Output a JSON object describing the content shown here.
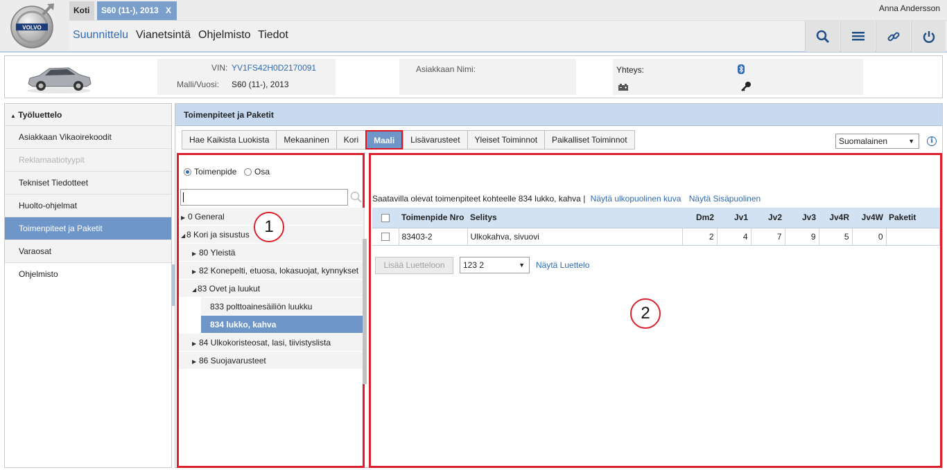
{
  "header": {
    "tabs": [
      {
        "label": "Koti"
      },
      {
        "label": "S60 (11-), 2013",
        "close": "X"
      }
    ],
    "user": "Anna Andersson",
    "nav": [
      {
        "label": "Suunnittelu",
        "active": true
      },
      {
        "label": "Vianetsintä"
      },
      {
        "label": "Ohjelmisto"
      },
      {
        "label": "Tiedot"
      }
    ],
    "toolbar_icons": [
      "search-icon",
      "list-icon",
      "link-icon",
      "power-icon"
    ]
  },
  "vehicle": {
    "vin_label": "VIN:",
    "vin": "YV1FS42H0D2170091",
    "model_label": "Malli/Vuosi:",
    "model": "S60 (11-), 2013",
    "customer_label": "Asiakkaan Nimi:",
    "connection_label": "Yhteys:",
    "icons": [
      "bluetooth-icon",
      "battery-icon",
      "key-icon"
    ]
  },
  "sidebar": {
    "title": "Työluettelo",
    "items": [
      {
        "label": "Asiakkaan Vikaoirekoodit"
      },
      {
        "label": "Reklamaatiotyypit",
        "disabled": true
      },
      {
        "label": "Tekniset Tiedotteet"
      },
      {
        "label": "Huolto-ohjelmat"
      },
      {
        "label": "Toimenpiteet ja Paketit",
        "active": true
      },
      {
        "label": "Varaosat"
      },
      {
        "label": "Ohjelmisto"
      }
    ]
  },
  "main": {
    "title": "Toimenpiteet ja Paketit",
    "tabs": [
      "Hae Kaikista Luokista",
      "Mekaaninen",
      "Kori",
      "Maali",
      "Lisävarusteet",
      "Yleiset Toiminnot",
      "Paikalliset Toiminnot"
    ],
    "active_tab": "Maali",
    "language": "Suomalainen",
    "info_icon": "i"
  },
  "panel1": {
    "callout": "1",
    "radio_operation": "Toimenpide",
    "radio_part": "Osa",
    "search_value": "",
    "tree": [
      {
        "label": "0 General",
        "level": 0,
        "state": "collapsed"
      },
      {
        "label": "8 Kori ja sisustus",
        "level": 0,
        "state": "expanded"
      },
      {
        "label": "80 Yleistä",
        "level": 1,
        "state": "collapsed"
      },
      {
        "label": "82 Konepelti, etuosa, lokasuojat, kynnykset",
        "level": 1,
        "state": "collapsed"
      },
      {
        "label": "83 Ovet ja luukut",
        "level": 1,
        "state": "expanded"
      },
      {
        "label": "833 polttoainesäiliön luukku",
        "level": 2,
        "state": "leaf"
      },
      {
        "label": "834 lukko, kahva",
        "level": 2,
        "state": "leaf",
        "selected": true
      },
      {
        "label": "84 Ulkokoristeosat, lasi, tiivistyslista",
        "level": 1,
        "state": "collapsed"
      },
      {
        "label": "86 Suojavarusteet",
        "level": 1,
        "state": "collapsed"
      }
    ]
  },
  "panel2": {
    "callout": "2",
    "available_text": "Saatavilla olevat toimenpiteet kohteelle 834 lukko, kahva |",
    "link_outside": "Näytä ulkopuolinen kuva",
    "link_inside": "Näytä Sisäpuolinen",
    "columns": [
      "Toimenpide Nro",
      "Selitys",
      "Dm2",
      "Jv1",
      "Jv2",
      "Jv3",
      "Jv4R",
      "Jv4W",
      "Paketit"
    ],
    "rows": [
      {
        "nro": "83403-2",
        "selitys": "Ulkokahva, sivuovi",
        "dm2": "2",
        "jv1": "4",
        "jv2": "7",
        "jv3": "9",
        "jv4r": "5",
        "jv4w": "0",
        "paketit": ""
      }
    ],
    "add_button": "Lisää Luetteloon",
    "list_select": "123 2",
    "show_list": "Näytä Luettelo"
  }
}
